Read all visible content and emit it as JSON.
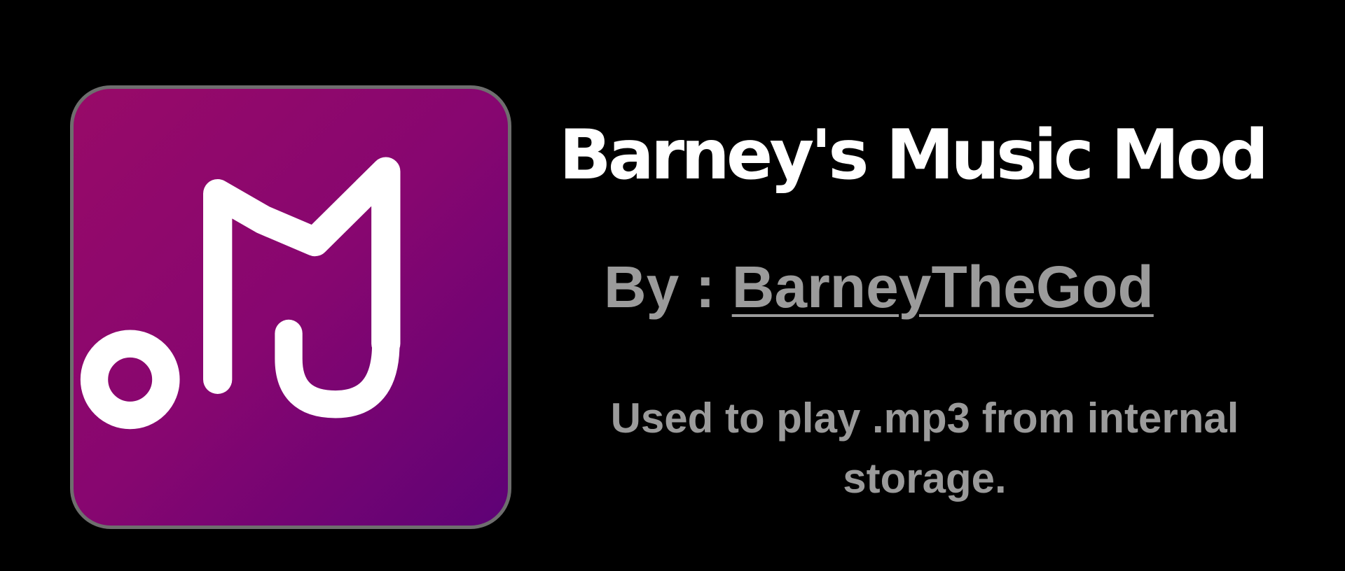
{
  "icon": {
    "name": "music-note-icon",
    "background_colors": [
      "#980a68",
      "#870670",
      "#5e0276"
    ],
    "glyph_color": "#ffffff",
    "border_color": "#6e6e6e"
  },
  "title": "Barney's Music Mod",
  "byline": {
    "prefix": "By :",
    "author": "BarneyTheGod"
  },
  "description": "Used to play .mp3 from internal storage.",
  "colors": {
    "background": "#000000",
    "title": "#ffffff",
    "secondary_text": "#9b9b9b"
  }
}
